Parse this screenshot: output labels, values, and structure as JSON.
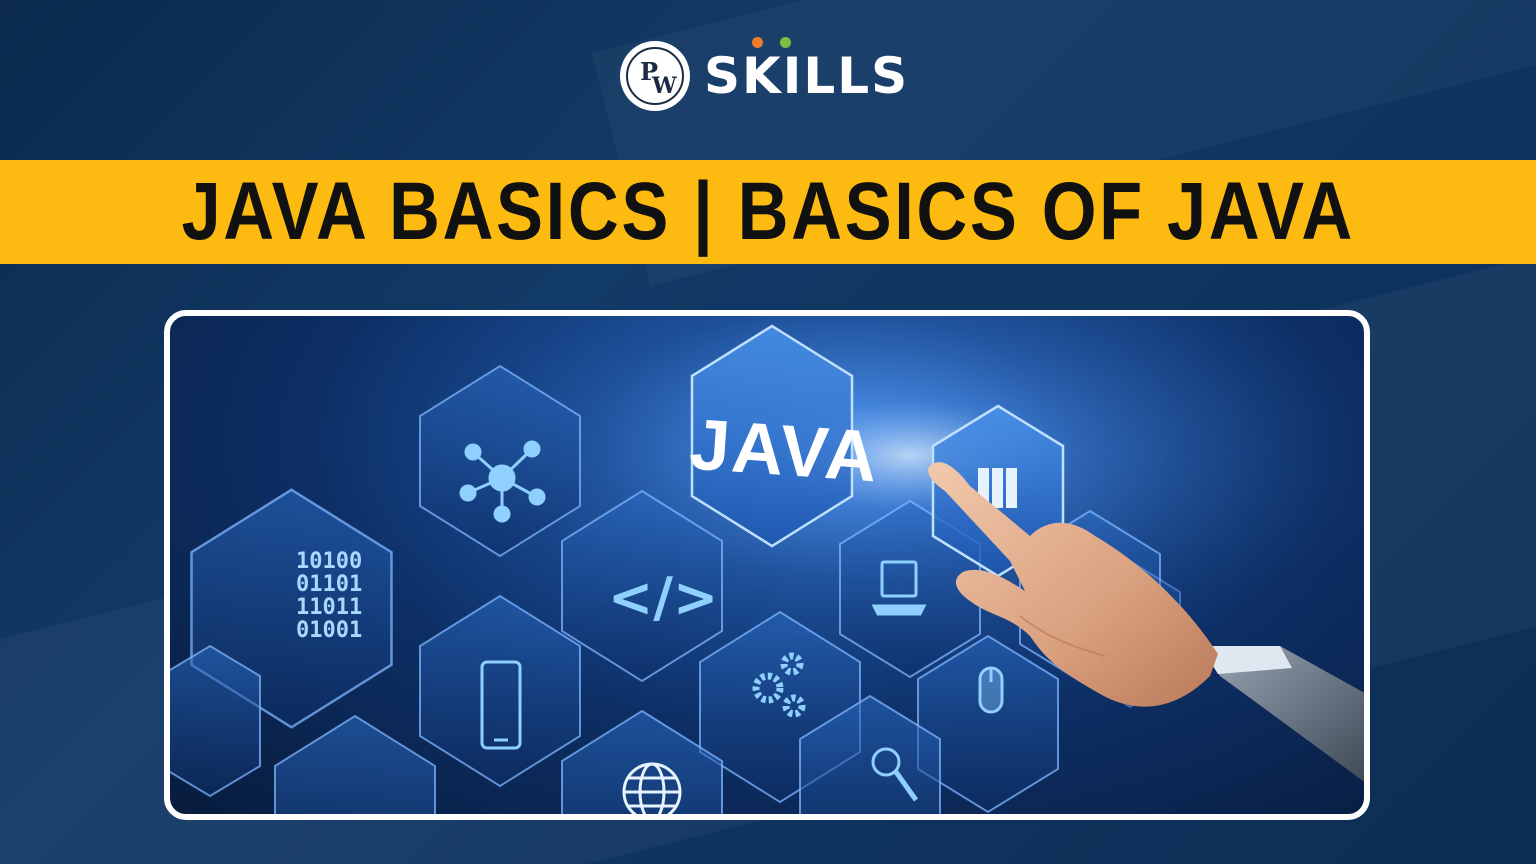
{
  "brand": {
    "badge_letter_top": "P",
    "badge_letter_bottom": "W",
    "name": "SKILLS",
    "dot_colors": [
      "#f07c2a",
      "#7bc043"
    ]
  },
  "banner": {
    "title": "JAVA BASICS | BASICS OF JAVA",
    "background_color": "#fdbb12"
  },
  "illustration": {
    "center_label": "JAVA",
    "binary_lines": [
      "10100",
      "01101",
      "11011",
      "01001"
    ],
    "code_glyph": "</>",
    "icons": [
      "network-icon",
      "binary-icon",
      "code-icon",
      "server-icon",
      "laptop-icon",
      "smartphone-icon",
      "gears-icon",
      "mouse-icon",
      "magnifier-icon",
      "globe-icon",
      "pointing-hand"
    ]
  }
}
